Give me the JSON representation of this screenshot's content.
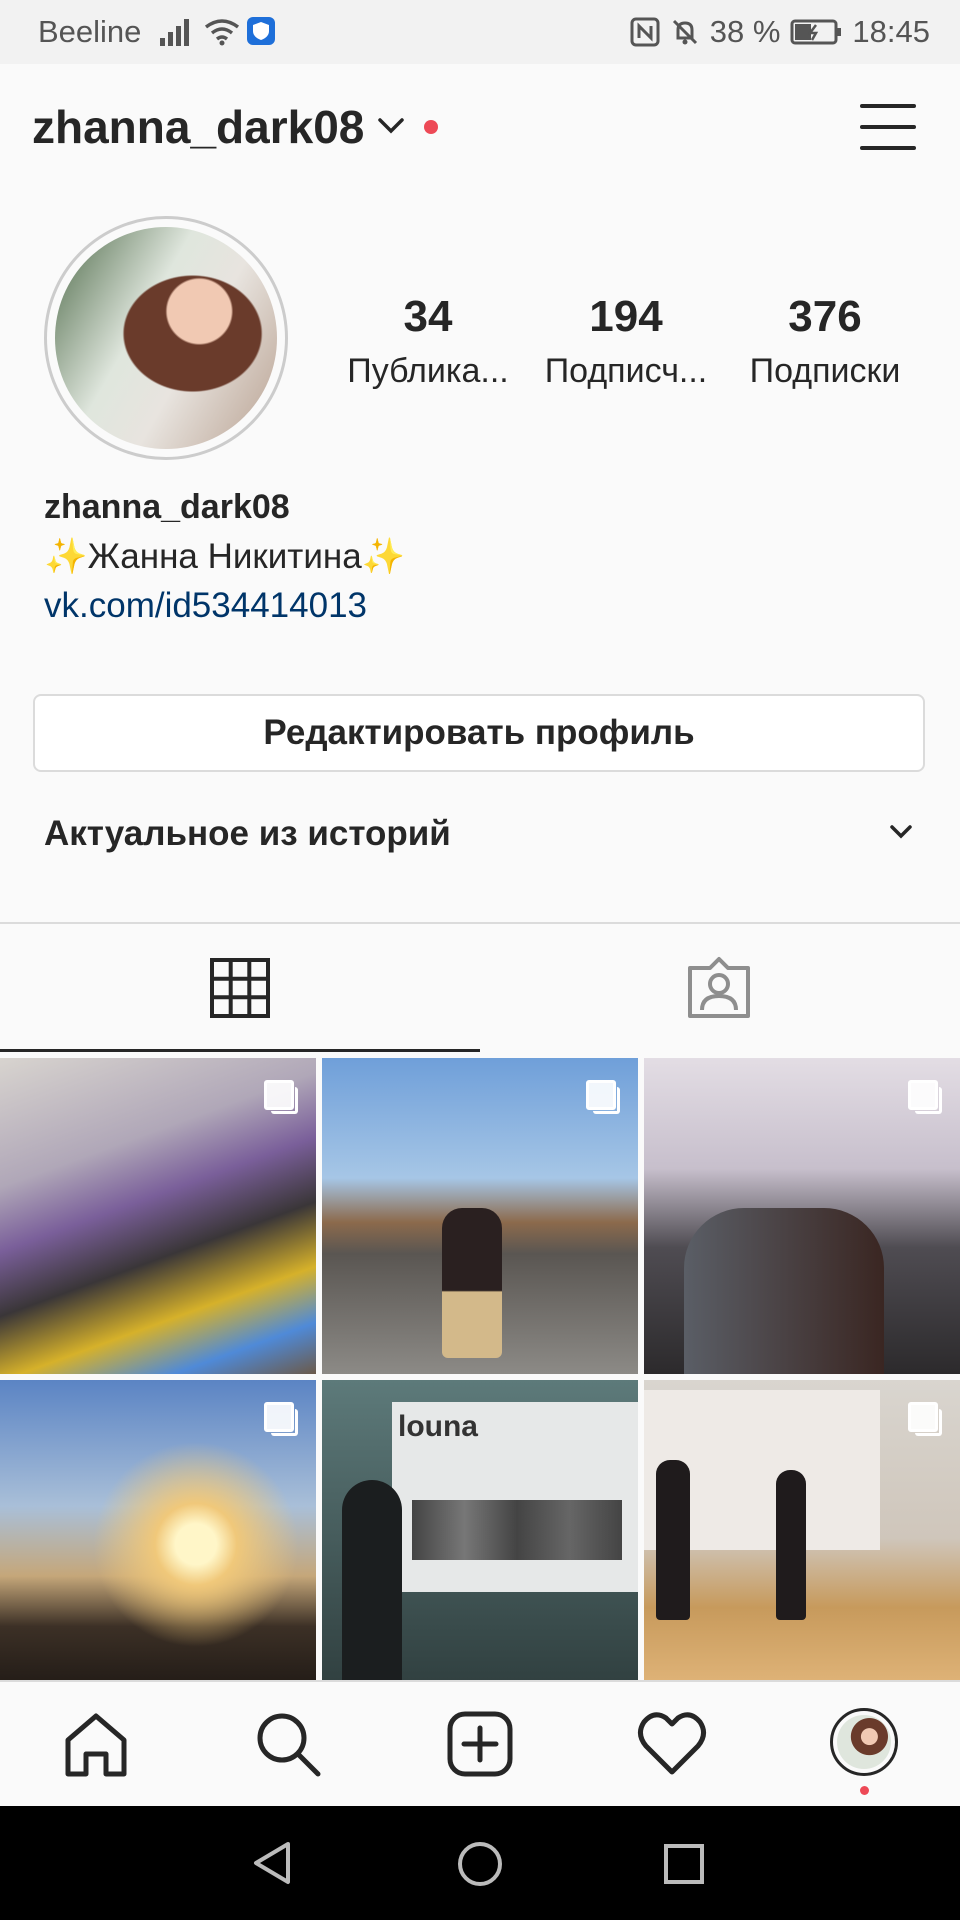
{
  "status_bar": {
    "carrier": "Beeline",
    "battery": "38 %",
    "time": "18:45"
  },
  "header": {
    "username": "zhanna_dark08"
  },
  "stats": [
    {
      "value": "34",
      "label": "Публика..."
    },
    {
      "value": "194",
      "label": "Подписч..."
    },
    {
      "value": "376",
      "label": "Подписки"
    }
  ],
  "bio": {
    "username": "zhanna_dark08",
    "full_name": "✨Жанна Никитина✨",
    "link": "vk.com/id534414013"
  },
  "edit_profile_label": "Редактировать профиль",
  "highlights_label": "Актуальное из историй",
  "posts": [
    {
      "caption": "",
      "multi": true
    },
    {
      "caption": "",
      "multi": true
    },
    {
      "caption": "",
      "multi": true
    },
    {
      "caption": "",
      "multi": true
    },
    {
      "caption": "louna",
      "multi": false
    },
    {
      "caption": "",
      "multi": true
    }
  ],
  "colors": {
    "accent_dot": "#ed4956",
    "link": "#003569",
    "text": "#262626"
  },
  "icons": [
    "home-icon",
    "search-icon",
    "new-post-icon",
    "activity-heart-icon",
    "profile-avatar",
    "back-icon",
    "home-circle-icon",
    "recents-icon"
  ]
}
